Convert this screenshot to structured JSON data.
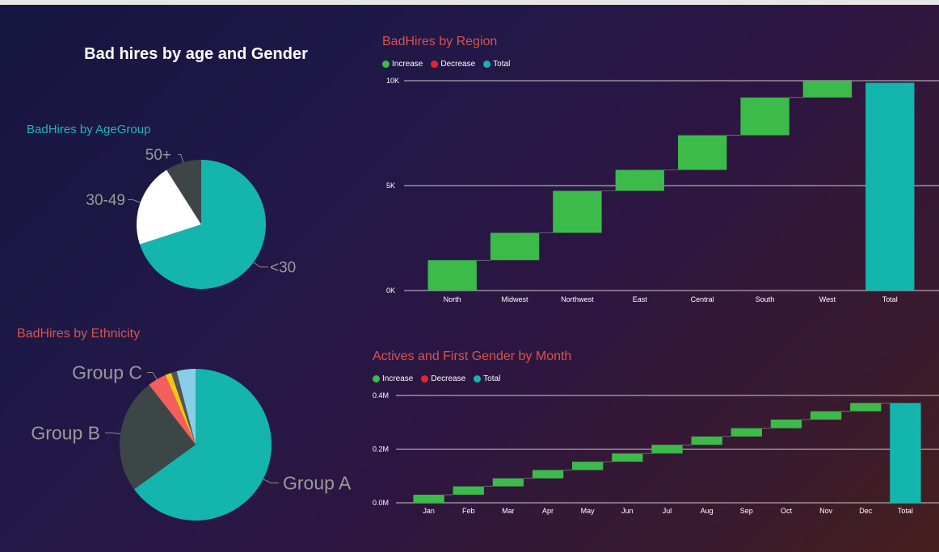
{
  "header": {
    "title": "Bad hires by age and Gender"
  },
  "colors": {
    "increase": "#3cba4a",
    "decrease": "#e8232f",
    "total": "#14b5ac",
    "title_teal": "#21b5b5",
    "title_red": "#d9534f"
  },
  "age_chart": {
    "title": "BadHires by AgeGroup"
  },
  "ethnicity_chart": {
    "title": "BadHires by Ethnicity"
  },
  "region_chart": {
    "title": "BadHires by Region",
    "legend": {
      "increase": "Increase",
      "decrease": "Decrease",
      "total": "Total"
    }
  },
  "month_chart": {
    "title": "Actives and First Gender by Month",
    "legend": {
      "increase": "Increase",
      "decrease": "Decrease",
      "total": "Total"
    }
  },
  "chart_data": [
    {
      "type": "pie",
      "title": "BadHires by AgeGroup",
      "slices": [
        {
          "label": "<30",
          "value": 70,
          "color": "#14b5ac"
        },
        {
          "label": "30-49",
          "value": 21,
          "color": "#ffffff"
        },
        {
          "label": "50+",
          "value": 9,
          "color": "#3d4647"
        }
      ]
    },
    {
      "type": "pie",
      "title": "BadHires by Ethnicity",
      "slices": [
        {
          "label": "Group A",
          "value": 65,
          "color": "#14b5ac"
        },
        {
          "label": "Group B",
          "value": 24.5,
          "color": "#3d4647"
        },
        {
          "label": "Group C",
          "value": 4,
          "color": "#f25f5c"
        },
        {
          "label": "",
          "value": 1.3,
          "color": "#f2c811"
        },
        {
          "label": "",
          "value": 1.2,
          "color": "#555555"
        },
        {
          "label": "",
          "value": 4,
          "color": "#87ceeb"
        }
      ]
    },
    {
      "type": "waterfall",
      "title": "BadHires by Region",
      "categories": [
        "North",
        "Midwest",
        "Northwest",
        "East",
        "Central",
        "South",
        "West",
        "Total"
      ],
      "values": [
        1450,
        1300,
        2000,
        1000,
        1650,
        1800,
        800,
        9900
      ],
      "y_ticks": [
        "0K",
        "5K",
        "10K"
      ],
      "ylim": [
        0,
        10000
      ],
      "legend": [
        "Increase",
        "Decrease",
        "Total"
      ]
    },
    {
      "type": "waterfall",
      "title": "Actives and First Gender by Month",
      "categories": [
        "Jan",
        "Feb",
        "Mar",
        "Apr",
        "May",
        "Jun",
        "Jul",
        "Aug",
        "Sep",
        "Oct",
        "Nov",
        "Dec",
        "Total"
      ],
      "values": [
        30000,
        31000,
        30000,
        31000,
        31000,
        31000,
        32000,
        31000,
        31000,
        32000,
        31000,
        31000,
        372000
      ],
      "y_ticks": [
        "0.0M",
        "0.2M",
        "0.4M"
      ],
      "ylim": [
        0,
        400000
      ],
      "legend": [
        "Increase",
        "Decrease",
        "Total"
      ]
    }
  ]
}
